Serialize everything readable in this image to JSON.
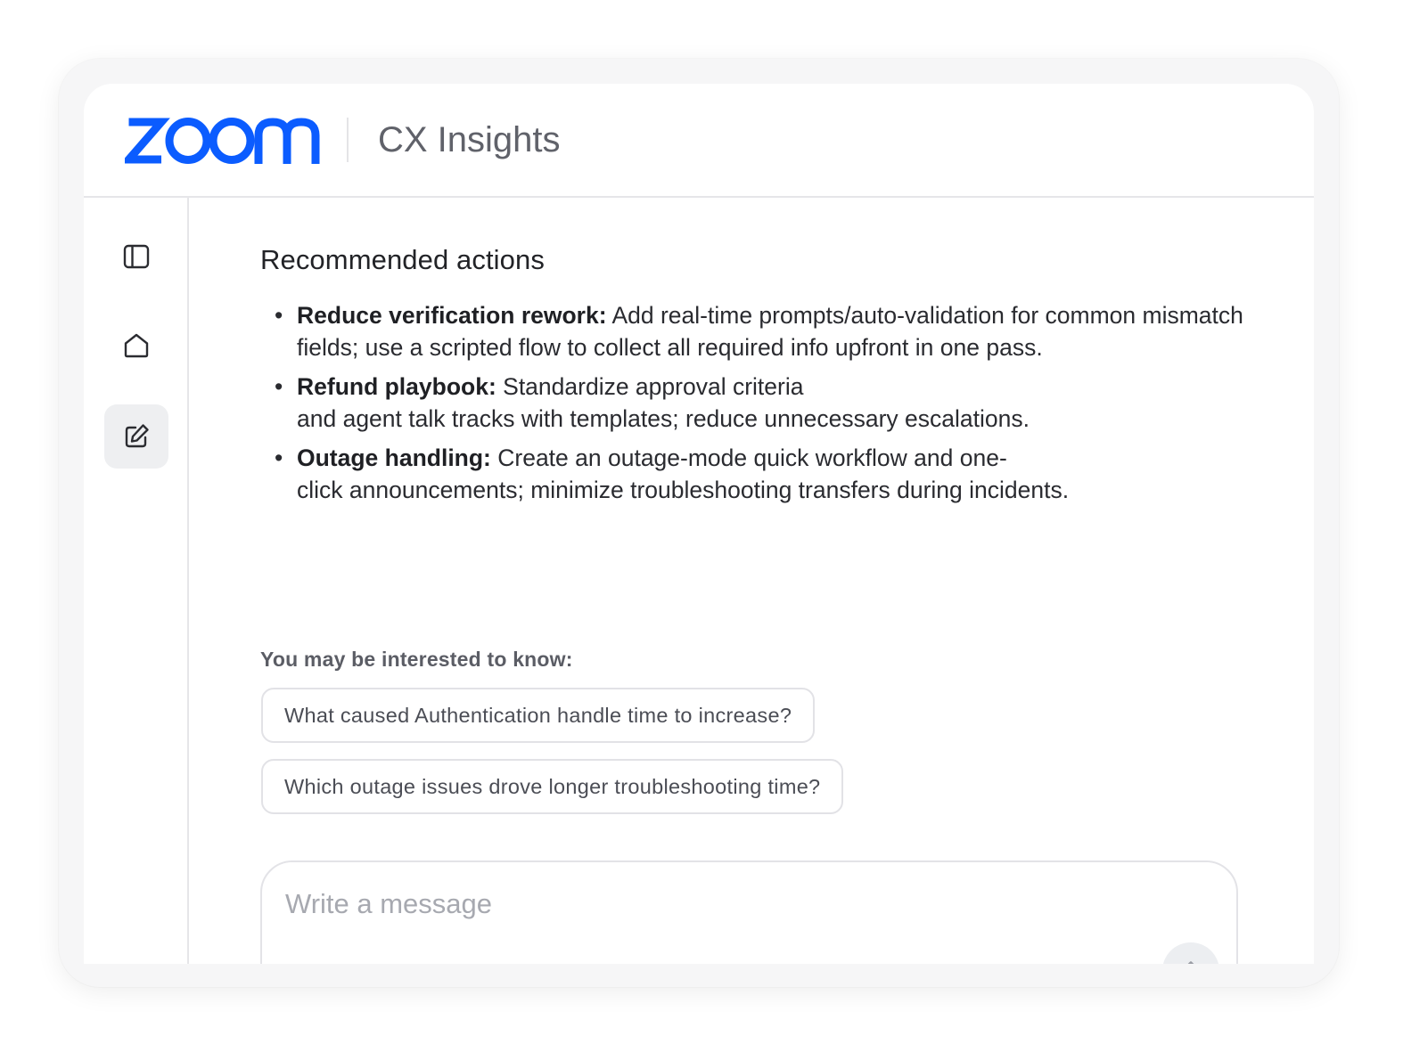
{
  "header": {
    "logo_text": "zoom",
    "app_title": "CX Insights",
    "brand_color": "#0b5cff"
  },
  "sidebar": {
    "items": [
      {
        "icon": "sidebar-toggle-icon",
        "active": false
      },
      {
        "icon": "home-icon",
        "active": false
      },
      {
        "icon": "edit-icon",
        "active": true
      }
    ]
  },
  "main": {
    "section_title": "Recommended actions",
    "actions": [
      {
        "title": "Reduce verification rework:",
        "text": " Add real-time prompts/auto-validation for common mismatch fields; use a scripted flow to collect all required info upfront in one pass."
      },
      {
        "title": "Refund playbook:",
        "line1": " Standardize approval criteria",
        "line2": "and agent talk tracks with templates; reduce unnecessary escalations."
      },
      {
        "title": "Outage handling:",
        "line1": " Create an outage-mode quick workflow and one-",
        "line2": "click announcements; minimize troubleshooting transfers during incidents."
      }
    ],
    "suggestions_label": "You may be interested to know:",
    "suggestions": [
      "What caused Authentication handle time to increase?",
      "Which outage issues drove longer troubleshooting time?"
    ]
  },
  "composer": {
    "placeholder": "Write a message",
    "value": "",
    "send_icon": "arrow-up-icon"
  }
}
